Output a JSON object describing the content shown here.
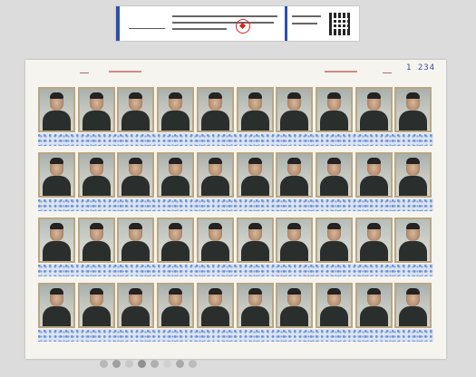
{
  "label": {
    "signature": "",
    "title_line1": "",
    "title_line2": "",
    "title_line3": ""
  },
  "sheet": {
    "number": "1 234",
    "top_margin_texts": []
  },
  "stamps": {
    "rows": 4,
    "per_row": 10,
    "frame_color": "#b9a784",
    "background_color": "#c7cac2",
    "strip_color": "#dbe4f4",
    "strip_dot_color": "#6f8fd0"
  },
  "colors": {
    "label_band": "#2a50b0",
    "seal": "#dd2222",
    "sheet_number": "#3a4a9a",
    "slab_background": "#dcdcdc"
  },
  "color_dots": [
    "#b8b8b8",
    "#a0a0a0",
    "#c8c8c8",
    "#909090",
    "#b0b0b0",
    "#d0d0d0",
    "#a8a8a8",
    "#bcbcbc"
  ]
}
